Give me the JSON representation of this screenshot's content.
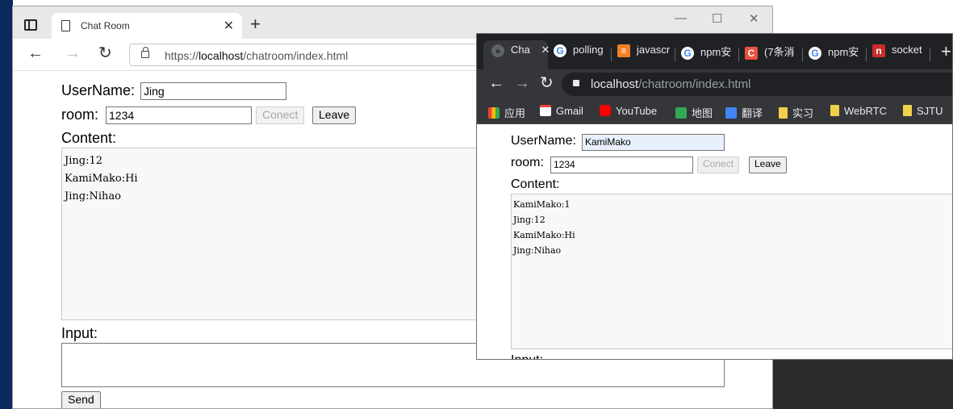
{
  "edge": {
    "tab_title": "Chat Room",
    "tab_close": "✕",
    "new_tab": "+",
    "win_minimize": "—",
    "win_maximize": "☐",
    "win_close": "✕",
    "back": "←",
    "forward": "→",
    "refresh": "↻",
    "url_scheme": "https://",
    "url_host": "localhost",
    "url_path": "/chatroom/index.html"
  },
  "chatA": {
    "username_label": "UserName:",
    "username_value": "Jing",
    "room_label": "room:",
    "room_value": "1234",
    "connect_label": "Conect",
    "leave_label": "Leave",
    "content_label": "Content:",
    "messages": [
      "Jing:12",
      "KamiMako:Hi",
      "Jing:Nihao"
    ],
    "input_label": "Input:",
    "send_label": "Send"
  },
  "chrome": {
    "tabs": [
      "Cha",
      "polling",
      "javascr",
      "npm安",
      "(7条消",
      "npm安",
      "socket"
    ],
    "tab_close": "✕",
    "new_tab": "+",
    "back": "←",
    "forward": "→",
    "refresh": "↻",
    "url_host": "localhost",
    "url_path": "/chatroom/index.html",
    "bookmarks": [
      "应用",
      "Gmail",
      "YouTube",
      "地图",
      "翻译",
      "实习",
      "WebRTC",
      "SJTU"
    ]
  },
  "chatB": {
    "username_label": "UserName:",
    "username_value": "KamiMako",
    "room_label": "room:",
    "room_value": "1234",
    "connect_label": "Conect",
    "leave_label": "Leave",
    "content_label": "Content:",
    "messages": [
      "KamiMako:1",
      "Jing:12",
      "KamiMako:Hi",
      "Jing:Nihao"
    ],
    "input_label_partial": "Input:"
  },
  "colors": {
    "desktop_blue": "#0a2a5e",
    "chrome_dark": "#202124",
    "chrome_toolbar": "#35363a"
  }
}
